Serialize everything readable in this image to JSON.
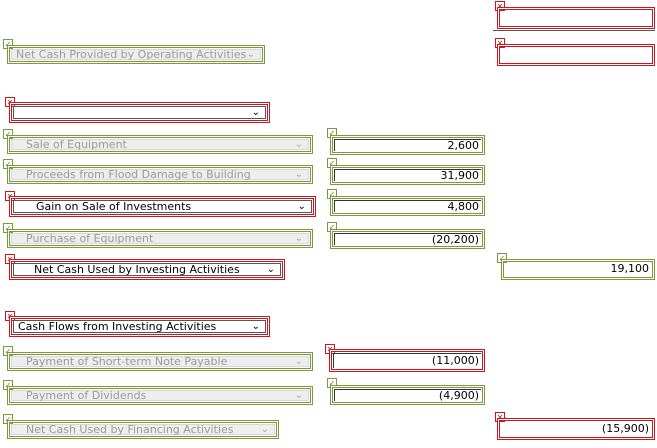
{
  "marks": {
    "ok": "✓",
    "bad": "✕"
  },
  "operating_total": {
    "label": "Net Cash Provided by Operating Activities"
  },
  "investing": {
    "heading": {
      "label": ""
    },
    "rows": [
      {
        "label": "Sale of Equipment",
        "amount": "2,600"
      },
      {
        "label": "Proceeds from Flood Damage to Building",
        "amount": "31,900"
      },
      {
        "label": "Gain on Sale of Investments",
        "amount": "4,800"
      },
      {
        "label": "Purchase of Equipment",
        "amount": "(20,200)"
      }
    ],
    "total": {
      "label": "Net Cash Used by Investing Activities",
      "amount": "19,100"
    }
  },
  "financing": {
    "heading": {
      "label": "Cash Flows from Investing Activities"
    },
    "rows": [
      {
        "label": "Payment of Short-term Note Payable",
        "amount": "(11,000)"
      },
      {
        "label": "Payment of Dividends",
        "amount": "(4,900)"
      }
    ],
    "total": {
      "label": "Net Cash Used by Financing Activities",
      "amount": "(15,900)"
    }
  },
  "colors": {
    "correct": "#7a9a3c",
    "incorrect": "#c8171e",
    "disabled_bg": "#eeeeee"
  },
  "icons": {
    "dropdown": "chevron-down-icon",
    "correct": "check-icon",
    "incorrect": "x-icon"
  }
}
